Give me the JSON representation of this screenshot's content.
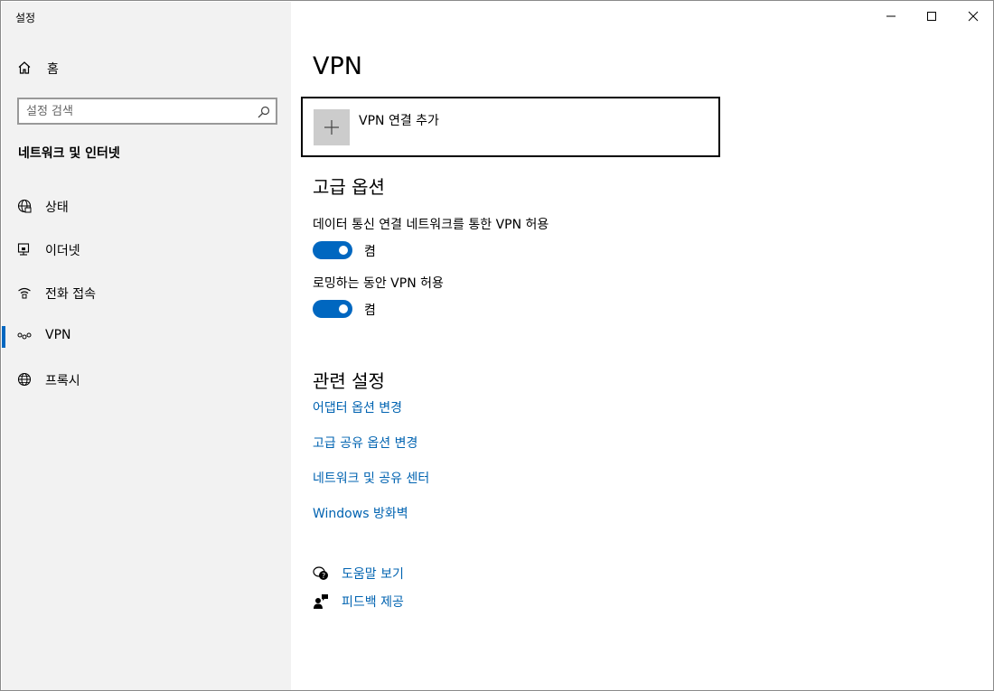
{
  "window": {
    "title": "설정",
    "controls": {
      "minimize": "minimize-icon",
      "maximize": "maximize-icon",
      "close": "close-icon"
    }
  },
  "sidebar": {
    "home_label": "홈",
    "search_placeholder": "설정 검색",
    "section_title": "네트워크 및 인터넷",
    "items": [
      {
        "label": "상태",
        "icon": "globe-status-icon",
        "active": false
      },
      {
        "label": "이더넷",
        "icon": "ethernet-icon",
        "active": false
      },
      {
        "label": "전화 접속",
        "icon": "dialup-icon",
        "active": false
      },
      {
        "label": "VPN",
        "icon": "vpn-icon",
        "active": true
      },
      {
        "label": "프록시",
        "icon": "globe-icon",
        "active": false
      }
    ]
  },
  "main": {
    "title": "VPN",
    "add_vpn_label": "VPN 연결 추가",
    "advanced": {
      "heading": "고급 옵션",
      "options": [
        {
          "label": "데이터 통신 연결 네트워크를 통한 VPN 허용",
          "state": "켬",
          "on": true
        },
        {
          "label": "로밍하는 동안 VPN 허용",
          "state": "켬",
          "on": true
        }
      ]
    },
    "related": {
      "heading": "관련 설정",
      "links": [
        "어댑터 옵션 변경",
        "고급 공유 옵션 변경",
        "네트워크 및 공유 센터",
        "Windows 방화벽"
      ]
    },
    "help": {
      "get_help": "도움말 보기",
      "feedback": "피드백 제공"
    }
  },
  "colors": {
    "accent": "#0067c0",
    "link": "#0063b1",
    "sidebar_bg": "#f2f2f2"
  }
}
